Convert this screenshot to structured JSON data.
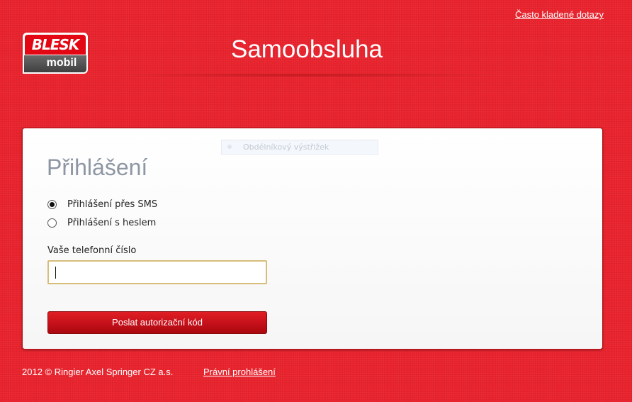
{
  "header": {
    "faq_link": "Často kladené dotazy",
    "title": "Samoobsluha",
    "logo": {
      "brand": "BLESK",
      "sub": "mobil"
    }
  },
  "overlay": {
    "label": "Obdélníkový výstřižek"
  },
  "login": {
    "heading": "Přihlášení",
    "options": [
      {
        "label": "Přihlášení přes SMS",
        "selected": true
      },
      {
        "label": "Přihlášení s heslem",
        "selected": false
      }
    ],
    "phone_label": "Vaše telefonní číslo",
    "phone_value": "",
    "submit_label": "Poslat autorizační kód"
  },
  "footer": {
    "copyright": "2012 © Ringier Axel Springer CZ a.s.",
    "legal_link": "Právní prohlášení"
  },
  "colors": {
    "background": "#e8222c",
    "button": "#c4101a",
    "heading": "#8d96a3",
    "input_border": "#d7bd7a"
  }
}
